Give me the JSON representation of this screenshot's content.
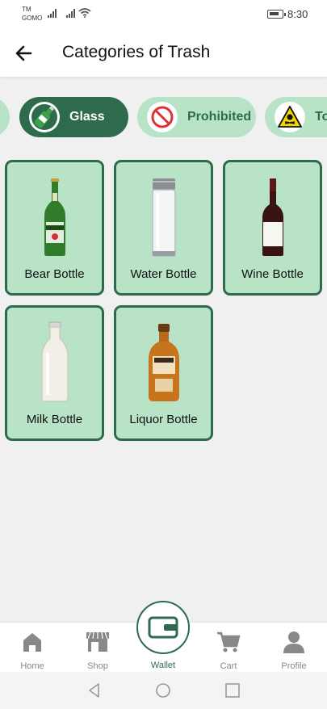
{
  "status_bar": {
    "carrier_top": "TM",
    "carrier_bottom": "GOMO",
    "time": "8:30"
  },
  "app_bar": {
    "title": "Categories of Trash",
    "back_icon": "arrow-left-icon"
  },
  "categories": [
    {
      "label": "",
      "icon": "partial-chip"
    },
    {
      "label": "Glass",
      "icon": "glass-bottle-icon",
      "active": true
    },
    {
      "label": "Prohibited",
      "icon": "prohibited-icon",
      "active": false
    },
    {
      "label": "To",
      "icon": "toxic-warning-icon",
      "active": false
    }
  ],
  "items": [
    {
      "label": "Bear Bottle",
      "icon": "beer-bottle-icon"
    },
    {
      "label": "Water Bottle",
      "icon": "water-bottle-icon"
    },
    {
      "label": "Wine Bottle",
      "icon": "wine-bottle-icon"
    },
    {
      "label": "Milk Bottle",
      "icon": "milk-bottle-icon"
    },
    {
      "label": "Liquor Bottle",
      "icon": "liquor-bottle-icon"
    }
  ],
  "bottom_nav": {
    "home": "Home",
    "shop": "Shop",
    "wallet": "Wallet",
    "cart": "Cart",
    "profile": "Profile"
  },
  "colors": {
    "primary": "#2e6b4c",
    "chip_bg": "#b8e3c6",
    "background": "#f0f0f0"
  }
}
